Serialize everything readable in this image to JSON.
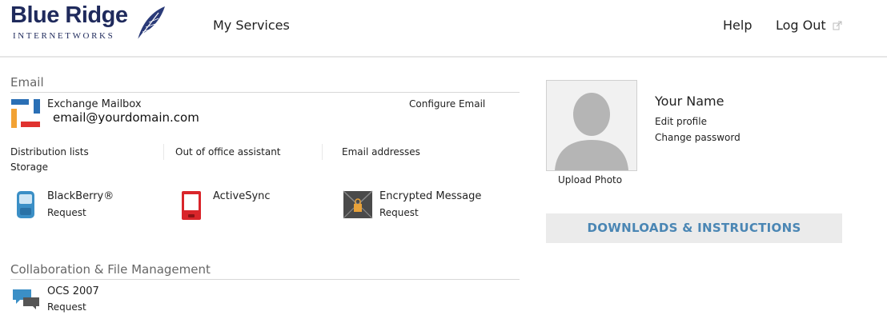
{
  "header": {
    "logo_main": "Blue Ridge",
    "logo_sub": "INTERNETWORKS",
    "nav_services": "My Services",
    "nav_help": "Help",
    "nav_logout": "Log Out"
  },
  "email": {
    "section_title": "Email",
    "mailbox_title": "Exchange Mailbox",
    "mailbox_address": "email@yourdomain.com",
    "configure_label": "Configure Email",
    "links": {
      "distribution_lists": "Distribution lists",
      "storage": "Storage",
      "out_of_office": "Out of office assistant",
      "email_addresses": "Email addresses"
    },
    "services": [
      {
        "name": "BlackBerry®",
        "action": "Request",
        "icon": "blackberry-phone-icon"
      },
      {
        "name": "ActiveSync",
        "action": "",
        "icon": "activesync-phone-icon"
      },
      {
        "name": "Encrypted Message",
        "action": "Request",
        "icon": "encrypted-message-icon"
      }
    ]
  },
  "collab": {
    "section_title": "Collaboration & File Management",
    "services": [
      {
        "name": "OCS 2007",
        "action": "Request",
        "icon": "chat-bubbles-icon"
      }
    ]
  },
  "profile": {
    "name": "Your Name",
    "edit_profile": "Edit profile",
    "change_password": "Change password",
    "upload_photo": "Upload Photo"
  },
  "downloads_button": "DOWNLOADS & INSTRUCTIONS",
  "colors": {
    "brand_navy": "#1f2a5c",
    "button_text": "#4a86b4",
    "button_bg": "#ebebeb"
  }
}
